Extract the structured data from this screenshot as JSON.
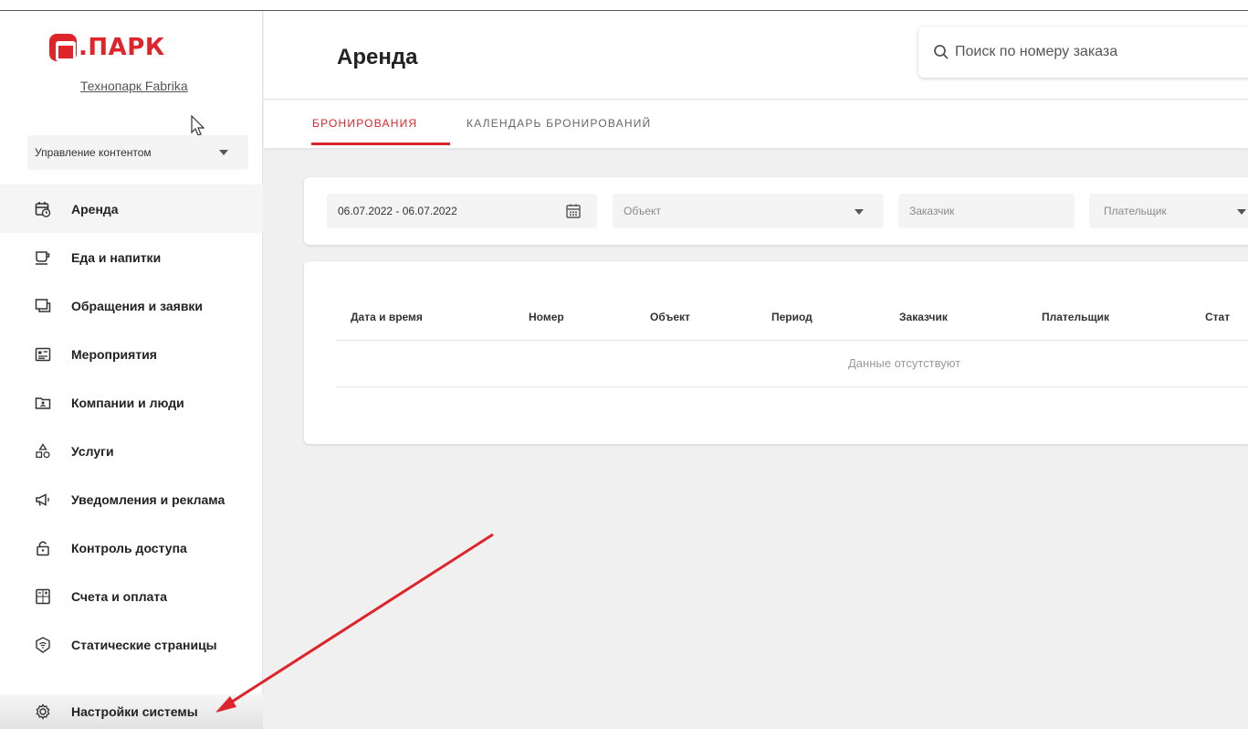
{
  "app": {
    "logo_text": ".ПАРК",
    "org_link": "Технопарк Fabrika",
    "mode_select_value": "Управление контентом",
    "brand_color": "#e0242b"
  },
  "sidebar": {
    "items": [
      {
        "label": "Аренда",
        "icon": "calendar-clock-icon",
        "active": true
      },
      {
        "label": "Еда и напитки",
        "icon": "cup-icon"
      },
      {
        "label": "Обращения и заявки",
        "icon": "chat-icon"
      },
      {
        "label": "Мероприятия",
        "icon": "event-card-icon"
      },
      {
        "label": "Компании и люди",
        "icon": "folder-person-icon"
      },
      {
        "label": "Услуги",
        "icon": "shapes-icon"
      },
      {
        "label": "Уведомления и реклама",
        "icon": "megaphone-icon"
      },
      {
        "label": "Контроль доступа",
        "icon": "lock-icon"
      },
      {
        "label": "Счета и оплата",
        "icon": "calculator-icon"
      },
      {
        "label": "Статические страницы",
        "icon": "shield-wifi-icon"
      }
    ],
    "settings_label": "Настройки системы"
  },
  "header": {
    "title": "Аренда",
    "search_placeholder": "Поиск по номеру заказа"
  },
  "tabs": [
    {
      "label": "БРОНИРОВАНИЯ",
      "active": true
    },
    {
      "label": "КАЛЕНДАРЬ БРОНИРОВАНИЙ",
      "active": false
    }
  ],
  "filters": {
    "date_range": "06.07.2022 - 06.07.2022",
    "object_placeholder": "Объект",
    "customer_placeholder": "Заказчик",
    "payer_placeholder": "Плательщик"
  },
  "table": {
    "columns": [
      "Дата и время",
      "Номер",
      "Объект",
      "Период",
      "Заказчик",
      "Плательщик",
      "Стат"
    ],
    "empty_text": "Данные отсутствуют"
  }
}
